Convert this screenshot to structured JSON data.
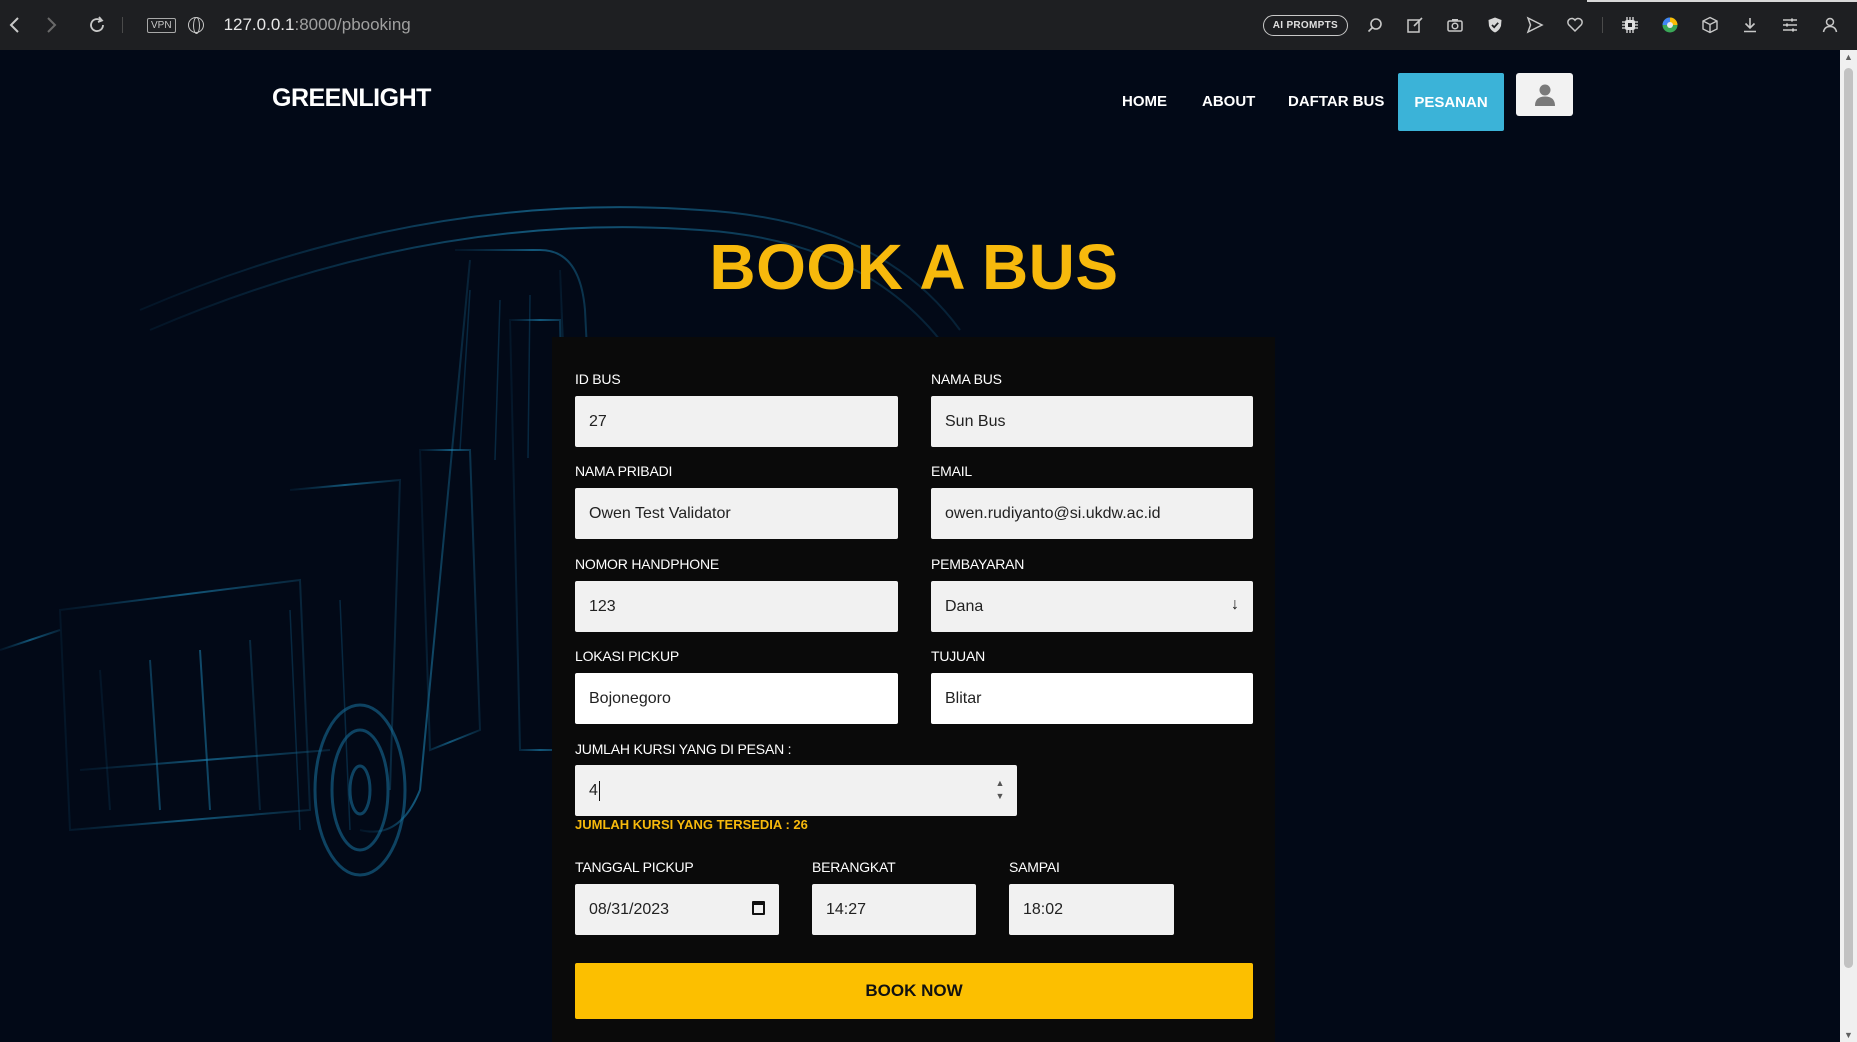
{
  "browser": {
    "vpn_label": "VPN",
    "url_host": "127.0.0.1",
    "url_path": ":8000/pbooking",
    "ai_prompts_label": "AI PROMPTS"
  },
  "nav": {
    "brand": "GREENLIGHT",
    "items": [
      {
        "label": "HOME"
      },
      {
        "label": "ABOUT"
      },
      {
        "label": "DAFTAR BUS"
      },
      {
        "label": "PESANAN"
      }
    ]
  },
  "page": {
    "title": "BOOK A BUS"
  },
  "form": {
    "id_bus": {
      "label": "ID BUS",
      "value": "27"
    },
    "nama_bus": {
      "label": "NAMA BUS",
      "value": "Sun Bus"
    },
    "nama_pribadi": {
      "label": "NAMA PRIBADI",
      "value": "Owen Test Validator"
    },
    "email": {
      "label": "EMAIL",
      "value": "owen.rudiyanto@si.ukdw.ac.id"
    },
    "nomor_hp": {
      "label": "NOMOR HANDPHONE",
      "value": "123"
    },
    "pembayaran": {
      "label": "PEMBAYARAN",
      "value": "Dana"
    },
    "lokasi_pickup": {
      "label": "LOKASI PICKUP",
      "value": "Bojonegoro"
    },
    "tujuan": {
      "label": "TUJUAN",
      "value": "Blitar"
    },
    "jumlah_kursi": {
      "label": "JUMLAH KURSI YANG DI PESAN :",
      "value": "4"
    },
    "kursi_tersedia": "JUMLAH KURSI YANG TERSEDIA : 26",
    "tanggal_pickup": {
      "label": "TANGGAL PICKUP",
      "value": "08/31/2023"
    },
    "berangkat": {
      "label": "BERANGKAT",
      "value": "14:27"
    },
    "sampai": {
      "label": "SAMPAI",
      "value": "18:02"
    },
    "submit_label": "BOOK NOW"
  },
  "colors": {
    "accent_yellow": "#fcbf00",
    "nav_active": "#3bb3d8",
    "background": "#020917"
  }
}
